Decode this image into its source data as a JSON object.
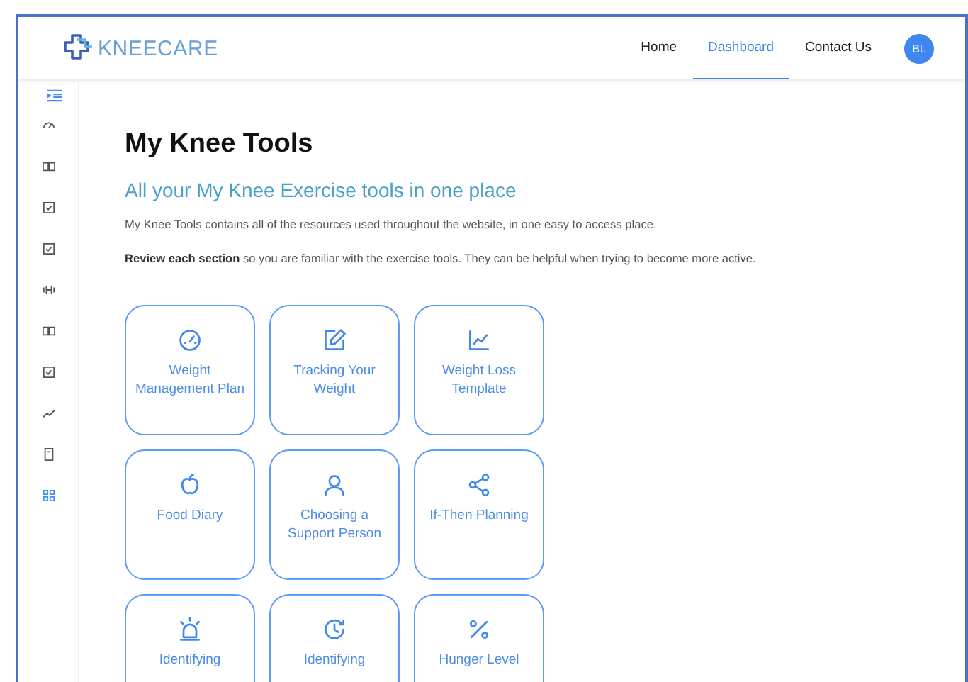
{
  "header": {
    "logo_text": "KNEECARE",
    "nav": [
      {
        "label": "Home",
        "selected": false
      },
      {
        "label": "Dashboard",
        "selected": true
      },
      {
        "label": "Contact Us",
        "selected": false
      }
    ],
    "avatar": "BL"
  },
  "sidebar": {
    "items": [
      {
        "selected": false
      },
      {
        "selected": false
      },
      {
        "selected": false
      },
      {
        "selected": false
      },
      {
        "selected": false
      },
      {
        "selected": false
      },
      {
        "selected": false
      },
      {
        "selected": false
      },
      {
        "selected": false
      },
      {
        "selected": true
      }
    ]
  },
  "page": {
    "title": "My Knee Tools",
    "subtitle": "All your My Knee Exercise tools in one place",
    "paragraphs": [
      "My Knee Tools contains all of the resources used throughout the website, in one easy to access place.",
      "**Review each section** so you are familiar with the exercise tools. They can be helpful when trying to become more active."
    ]
  },
  "tools": [
    {
      "label": "Weight Management Plan"
    },
    {
      "label": "Tracking Your Weight"
    },
    {
      "label": "Weight Loss Template"
    },
    {
      "label": "Food Diary"
    },
    {
      "label": "Choosing a Support Person"
    },
    {
      "label": "If-Then Planning"
    },
    {
      "label": "Identifying"
    },
    {
      "label": "Identifying"
    },
    {
      "label": "Hunger Level"
    }
  ]
}
